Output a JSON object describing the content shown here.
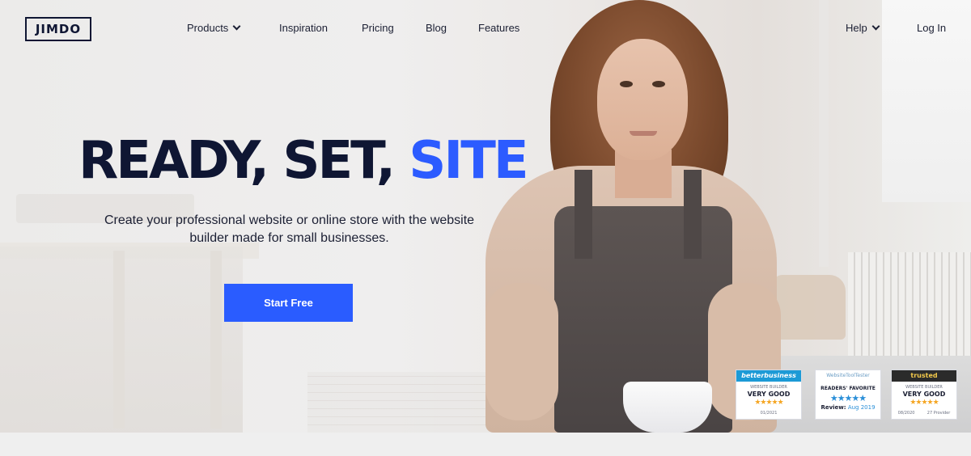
{
  "nav": {
    "logo": "JIMDO",
    "items": [
      {
        "label": "Products",
        "has_dropdown": true
      },
      {
        "label": "Inspiration",
        "has_dropdown": false
      },
      {
        "label": "Pricing",
        "has_dropdown": false
      },
      {
        "label": "Blog",
        "has_dropdown": false
      },
      {
        "label": "Features",
        "has_dropdown": false
      }
    ],
    "help": {
      "label": "Help",
      "has_dropdown": true
    },
    "login": "Log In"
  },
  "hero": {
    "headline": {
      "part1": "READY",
      "part2": "SET",
      "part3": "SITE",
      "separator": ","
    },
    "subtitle": "Create your professional website or online store with the website builder made for small businesses.",
    "cta": "Start Free"
  },
  "badges": [
    {
      "brand": "betterbusiness",
      "category": "WEBSITE BUILDER",
      "rating": "VERY GOOD",
      "stars": "★★★★★",
      "date": "01/2021"
    },
    {
      "brand": "WebsiteToolTester",
      "category": "READERS' FAVORITE",
      "stars": "★★★★★",
      "review_label": "Review:",
      "review_date": "Aug 2019"
    },
    {
      "brand": "trusted",
      "category": "WEBSITE BUILDER",
      "rating": "VERY GOOD",
      "stars": "★★★★★",
      "date": "08/2020",
      "provider": "27 Provider"
    }
  ],
  "colors": {
    "accent": "#2a5cff",
    "navy": "#0f1633",
    "star": "#f5a623",
    "bb_blue": "#1c9ad6",
    "trusted_dark": "#2b2b2b"
  },
  "icons": [
    "chevron-down-icon",
    "star-icon"
  ]
}
